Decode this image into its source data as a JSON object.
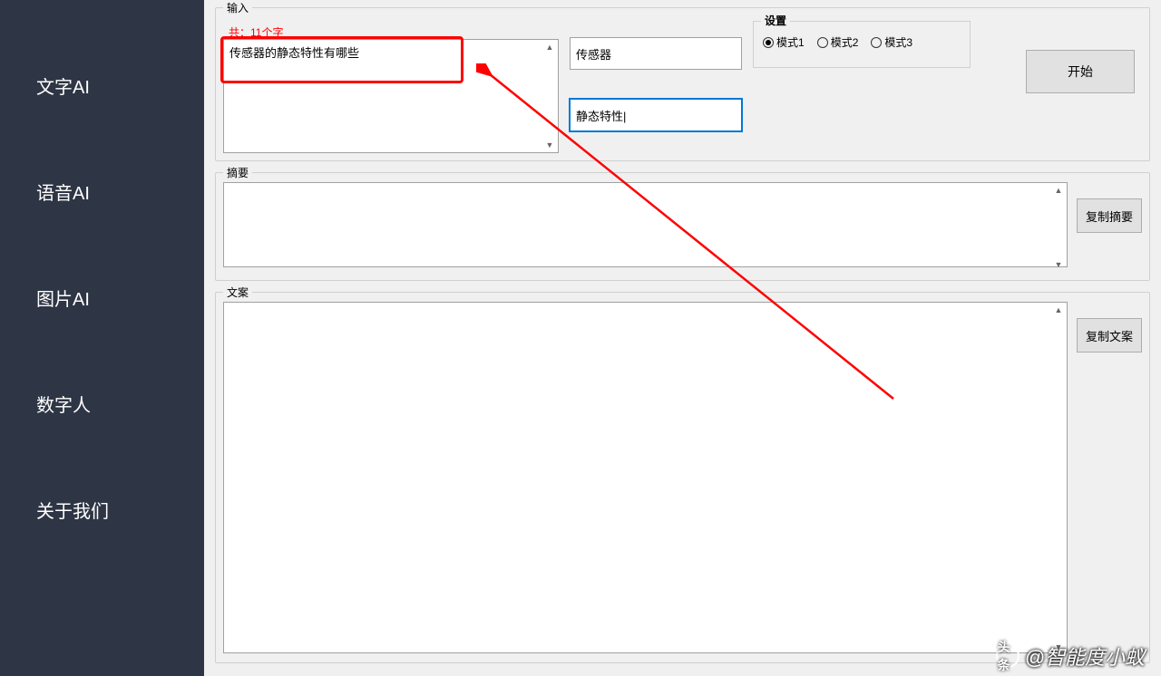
{
  "sidebar": {
    "items": [
      {
        "label": "文字AI"
      },
      {
        "label": "语音AI"
      },
      {
        "label": "图片AI"
      },
      {
        "label": "数字人"
      },
      {
        "label": "关于我们"
      }
    ]
  },
  "input": {
    "group_label": "输入",
    "count_text": "共：11个字",
    "main_text": "传感器的静态特性有哪些",
    "field1": "传感器",
    "field2": "静态特性|"
  },
  "settings": {
    "group_label": "设置",
    "options": [
      {
        "label": "模式1",
        "checked": true
      },
      {
        "label": "模式2",
        "checked": false
      },
      {
        "label": "模式3",
        "checked": false
      }
    ]
  },
  "buttons": {
    "start": "开始",
    "copy_summary": "复制摘要",
    "copy_content": "复制文案"
  },
  "summary": {
    "group_label": "摘要",
    "text": ""
  },
  "content": {
    "group_label": "文案",
    "text": ""
  },
  "watermark": {
    "prefix": "头条",
    "text": "@智能度小蚁"
  }
}
